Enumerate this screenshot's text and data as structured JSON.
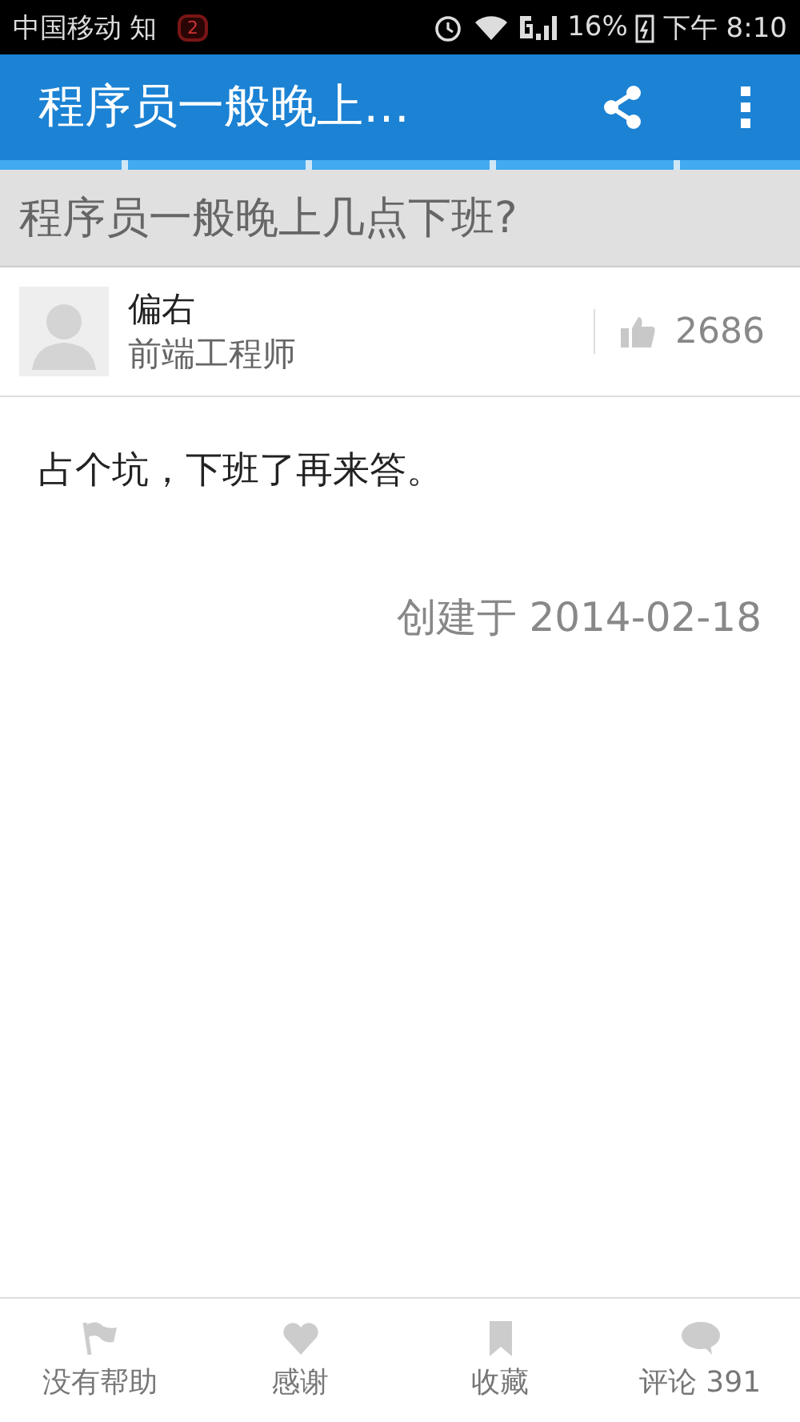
{
  "status_bar": {
    "carrier": "中国移动",
    "app_label": "知",
    "badge": "2",
    "battery": "16%",
    "time": "下午 8:10"
  },
  "app_bar": {
    "title": "程序员一般晚上…"
  },
  "question": {
    "title": "程序员一般晚上几点下班?"
  },
  "author": {
    "name": "偏右",
    "role": "前端工程师",
    "votes": "2686"
  },
  "answer": {
    "text": "占个坑，下班了再来答。",
    "created": "创建于 2014-02-18"
  },
  "actions": [
    {
      "kind": "flag",
      "label": "没有帮助"
    },
    {
      "kind": "heart",
      "label": "感谢"
    },
    {
      "kind": "bookmark",
      "label": "收藏"
    },
    {
      "kind": "comment",
      "label": "评论 391"
    }
  ]
}
